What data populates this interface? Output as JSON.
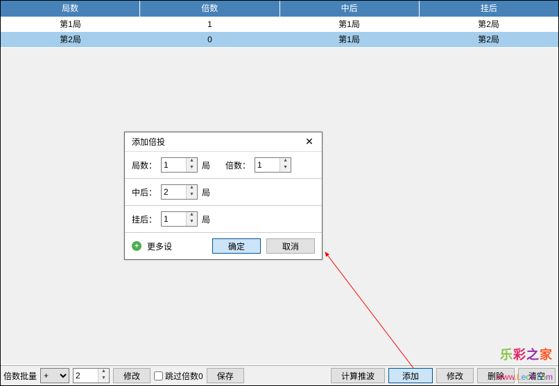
{
  "table": {
    "headers": [
      "局数",
      "倍数",
      "中后",
      "挂后"
    ],
    "rows": [
      {
        "cells": [
          "第1局",
          "1",
          "第1局",
          "第2局"
        ],
        "style": "white"
      },
      {
        "cells": [
          "第2局",
          "0",
          "第1局",
          "第2局"
        ],
        "style": "blue"
      }
    ]
  },
  "dialog": {
    "title": "添加倍投",
    "rounds_label": "局数：",
    "rounds_value": "1",
    "rounds_unit": "局",
    "mult_label": "倍数：",
    "mult_value": "1",
    "after_win_label": "中后：",
    "after_win_value": "2",
    "after_win_unit": "局",
    "after_lose_label": "挂后：",
    "after_lose_value": "1",
    "after_lose_unit": "局",
    "more_label": "更多设",
    "ok": "确定",
    "cancel": "取消"
  },
  "bottom": {
    "batch_label": "倍数批量",
    "op": "+",
    "value": "2",
    "modify": "修改",
    "skip_label": "跳过倍数0",
    "save": "保存",
    "calc": "计算推波",
    "add": "添加",
    "edit": "修改",
    "delete": "删除",
    "clear": "清空"
  },
  "watermark": {
    "c1": "乐",
    "c2": "彩",
    "c3": "之",
    "c4": "家",
    "url_w": "www.",
    "url_rest": "Lec6.com"
  }
}
